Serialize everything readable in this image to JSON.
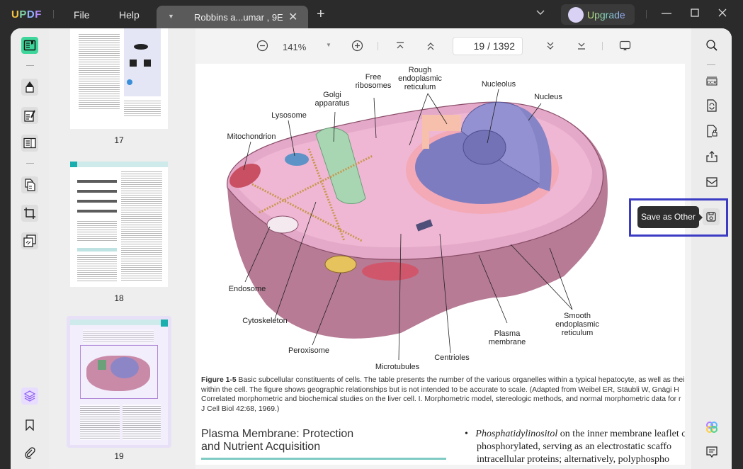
{
  "titlebar": {
    "logo": [
      "U",
      "P",
      "D",
      "F"
    ],
    "menus": [
      "File",
      "Help"
    ],
    "tab": {
      "name": "Robbins a...umar , 9E"
    },
    "upgrade_label": "Upgrade"
  },
  "toolbar": {
    "zoom_level": "141%",
    "current_page": "19",
    "page_sep": "/",
    "total_pages": "1392"
  },
  "thumbnails": [
    {
      "page": "17"
    },
    {
      "page": "18"
    },
    {
      "page": "19",
      "selected": true
    }
  ],
  "document": {
    "figure_labels": {
      "free_ribosomes": "Free\nribosomes",
      "rough_er": "Rough\nendoplasmic\nreticulum",
      "nucleolus": "Nucleolus",
      "nucleus": "Nucleus",
      "golgi": "Golgi\napparatus",
      "lysosome": "Lysosome",
      "mitochondrion": "Mitochondrion",
      "endosome": "Endosome",
      "cytoskeleton": "Cytoskeleton",
      "peroxisome": "Peroxisome",
      "microtubules": "Microtubules",
      "centrioles": "Centrioles",
      "plasma_membrane": "Plasma\nmembrane",
      "smooth_er": "Smooth\nendoplasmic\nreticulum"
    },
    "caption_title": "Figure 1-5",
    "caption_lines": [
      " Basic subcellular constituents of cells. The table presents the number of the various organelles within a typical hepatocyte, as well as their",
      "within the cell. The figure shows geographic relationships but is not intended to be accurate to scale. (Adapted from Weibel ER, Stäubli W, Gnägi H",
      "Correlated morphometric and biochemical studies on the liver cell. I. Morphometric model, stereologic methods, and normal morphometric data for r",
      "J Cell Biol 42:68, 1969.)"
    ],
    "section_heading": [
      "Plasma Membrane: Protection",
      "and Nutrient Acquisition"
    ],
    "bullet_term": "Phosphatidylinositol",
    "bullet_lines": [
      " on the inner membrane leaflet c",
      "phosphorylated, serving as an electrostatic scaffo",
      "intracellular proteins; alternatively, polyphospho"
    ]
  },
  "tooltip": {
    "save_as_other": "Save as Other"
  },
  "colors": {
    "accent_green": "#3ed69a",
    "highlight_blue": "#3b3bc4",
    "layers_purple": "#8b5cf6"
  }
}
